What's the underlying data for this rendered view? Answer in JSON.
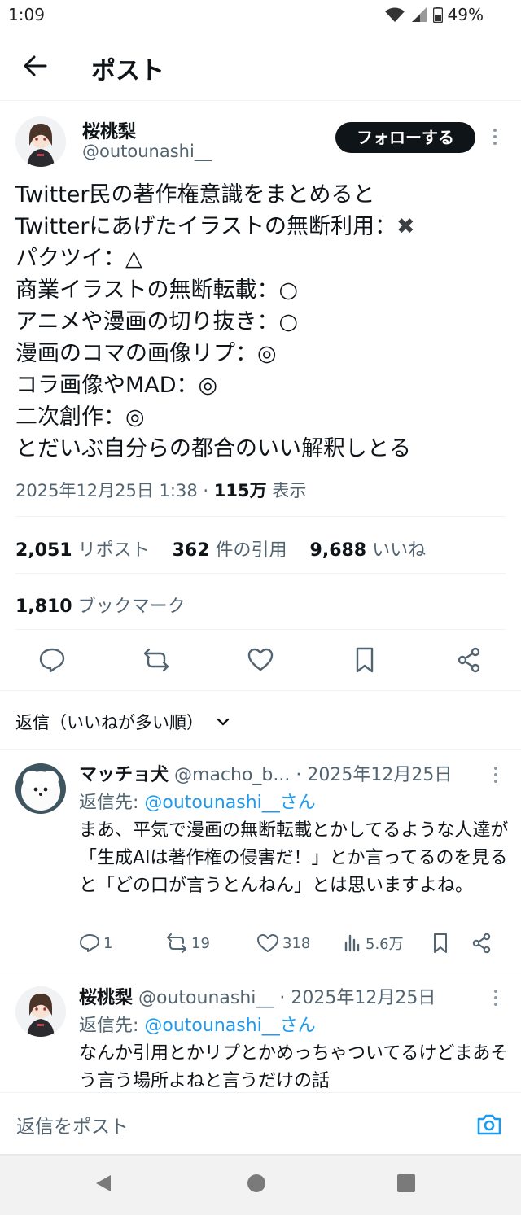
{
  "status_bar": {
    "time": "1:09",
    "battery": "49%"
  },
  "header": {
    "title": "ポスト"
  },
  "post": {
    "author_name": "桜桃梨",
    "author_handle": "@outounashi__",
    "follow_label": "フォローする",
    "lines": [
      "Twitter民の著作権意識をまとめると",
      "Twitterにあげたイラストの無断利用：",
      "パクツイ：△",
      "商業イラストの無断転載：○",
      "アニメや漫画の切り抜き：○",
      "漫画のコマの画像リプ：◎",
      "コラ画像やMAD：◎",
      "二次創作：◎",
      "とだいぶ自分らの都合のいい解釈しとる"
    ],
    "cross_mark": "✖",
    "datetime": "2025年12月25日 1:38",
    "sep": "·",
    "views": "115万",
    "views_label": "表示"
  },
  "stats": {
    "reposts": "2,051",
    "reposts_label": "リポスト",
    "quotes": "362",
    "quotes_label": "件の引用",
    "likes": "9,688",
    "likes_label": "いいね",
    "bookmarks": "1,810",
    "bookmarks_label": "ブックマーク"
  },
  "sort": {
    "label": "返信（いいねが多い順）"
  },
  "replies": [
    {
      "name": "マッチョ犬",
      "handle": "@macho_b...",
      "date": "· 2025年12月25日",
      "reply_to_prefix": "返信先: ",
      "reply_to_mention": "@outounashi__さん",
      "text": "まあ、平気で漫画の無断転載とかしてるような人達が「生成AIは著作権の侵害だ！」とか言ってるのを見ると「どの口が言うとんねん」とは思いますよね。",
      "replies_count": "1",
      "reposts_count": "19",
      "likes_count": "318",
      "views_count": "5.6万"
    },
    {
      "name": "桜桃梨",
      "handle": "@outounashi__",
      "date": "· 2025年12月25日",
      "reply_to_prefix": "返信先: ",
      "reply_to_mention": "@outounashi__さん",
      "text": "なんか引用とかリプとかめっちゃついてるけどまあそう言う場所よねと言うだけの話"
    }
  ],
  "compose": {
    "placeholder": "返信をポスト"
  },
  "colors": {
    "accent": "#1d9bf0",
    "text": "#0f1419",
    "secondary": "#536471"
  }
}
